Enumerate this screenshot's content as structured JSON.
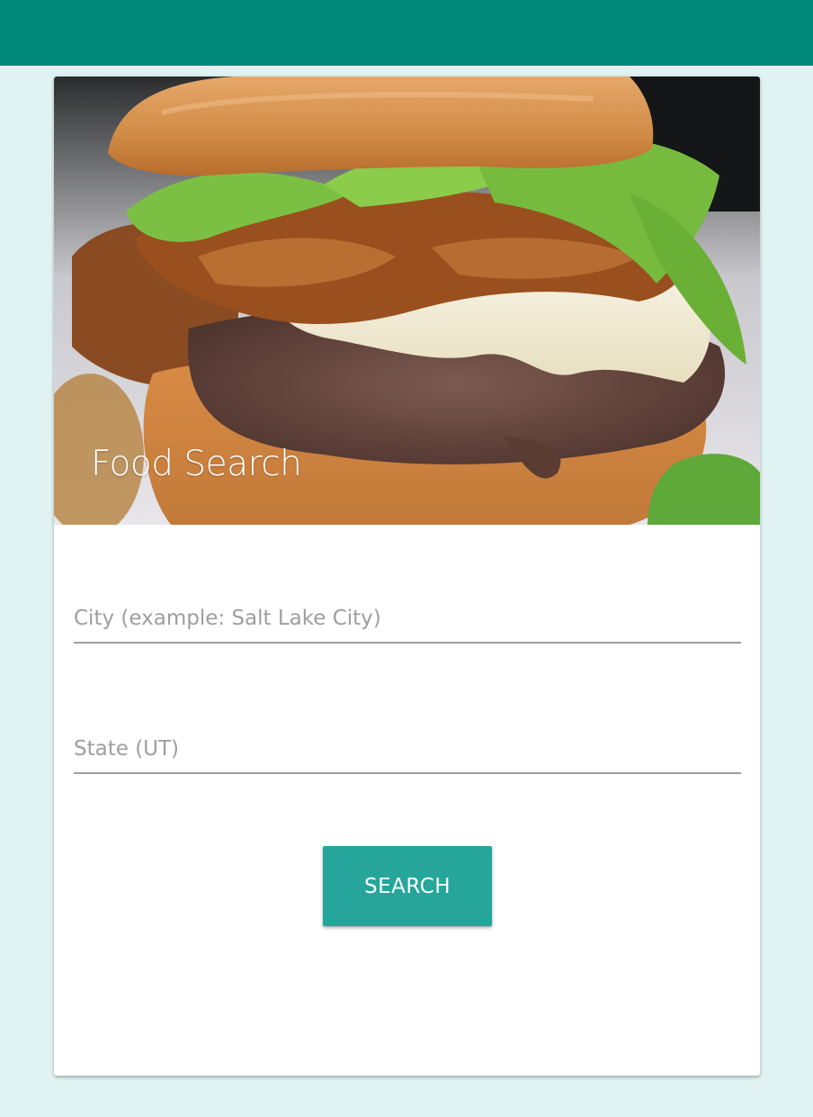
{
  "header": {
    "color": "#00897b"
  },
  "card": {
    "title": "Food Search",
    "image": "burger-photo",
    "form": {
      "city": {
        "value": "",
        "placeholder": "City (example: Salt Lake City)"
      },
      "state": {
        "value": "",
        "placeholder": "State (UT)"
      },
      "search_label": "SEARCH"
    }
  },
  "colors": {
    "page_background": "#e0f2f1",
    "button": "#26a69a",
    "input_underline": "#9e9e9e"
  }
}
